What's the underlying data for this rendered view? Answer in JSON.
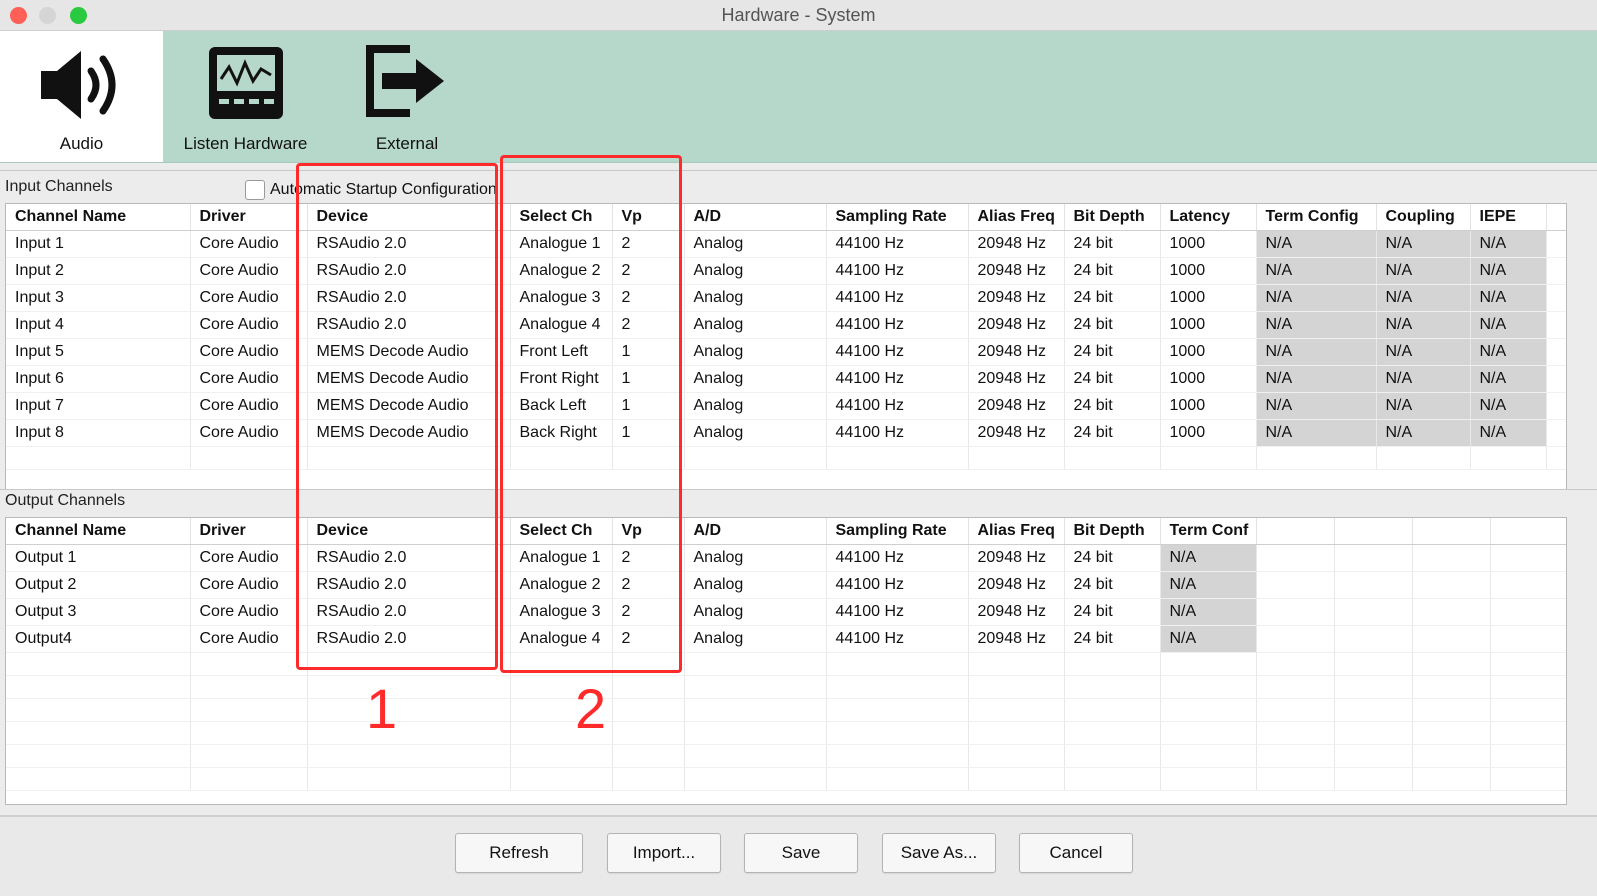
{
  "window": {
    "title": "Hardware - System"
  },
  "toolbar": {
    "items": [
      {
        "label": "Audio",
        "icon": "speaker-icon",
        "selected": true
      },
      {
        "label": "Listen Hardware",
        "icon": "waveform-monitor-icon",
        "selected": false
      },
      {
        "label": "External",
        "icon": "export-arrow-icon",
        "selected": false
      }
    ]
  },
  "input_section": {
    "label": "Input Channels",
    "auto_startup_label": "Automatic Startup Configuration",
    "auto_startup_checked": false,
    "columns": [
      "Channel Name",
      "Driver",
      "Device",
      "Select Ch",
      "Vp",
      "A/D",
      "Sampling Rate",
      "Alias Freq",
      "Bit Depth",
      "Latency",
      "Term Config",
      "Coupling",
      "IEPE"
    ],
    "rows": [
      [
        "Input 1",
        "Core Audio",
        "RSAudio 2.0",
        "Analogue 1",
        "2",
        "Analog",
        "44100 Hz",
        "20948 Hz",
        "24 bit",
        "1000",
        "N/A",
        "N/A",
        "N/A"
      ],
      [
        "Input 2",
        "Core Audio",
        "RSAudio 2.0",
        "Analogue 2",
        "2",
        "Analog",
        "44100 Hz",
        "20948 Hz",
        "24 bit",
        "1000",
        "N/A",
        "N/A",
        "N/A"
      ],
      [
        "Input 3",
        "Core Audio",
        "RSAudio 2.0",
        "Analogue 3",
        "2",
        "Analog",
        "44100 Hz",
        "20948 Hz",
        "24 bit",
        "1000",
        "N/A",
        "N/A",
        "N/A"
      ],
      [
        "Input 4",
        "Core Audio",
        "RSAudio 2.0",
        "Analogue 4",
        "2",
        "Analog",
        "44100 Hz",
        "20948 Hz",
        "24 bit",
        "1000",
        "N/A",
        "N/A",
        "N/A"
      ],
      [
        "Input 5",
        "Core Audio",
        "MEMS Decode Audio",
        "Front Left",
        "1",
        "Analog",
        "44100 Hz",
        "20948 Hz",
        "24 bit",
        "1000",
        "N/A",
        "N/A",
        "N/A"
      ],
      [
        "Input 6",
        "Core Audio",
        "MEMS Decode Audio",
        "Front Right",
        "1",
        "Analog",
        "44100 Hz",
        "20948 Hz",
        "24 bit",
        "1000",
        "N/A",
        "N/A",
        "N/A"
      ],
      [
        "Input 7",
        "Core Audio",
        "MEMS Decode Audio",
        "Back Left",
        "1",
        "Analog",
        "44100 Hz",
        "20948 Hz",
        "24 bit",
        "1000",
        "N/A",
        "N/A",
        "N/A"
      ],
      [
        "Input 8",
        "Core Audio",
        "MEMS Decode Audio",
        "Back Right",
        "1",
        "Analog",
        "44100 Hz",
        "20948 Hz",
        "24 bit",
        "1000",
        "N/A",
        "N/A",
        "N/A"
      ]
    ]
  },
  "output_section": {
    "label": "Output Channels",
    "columns": [
      "Channel Name",
      "Driver",
      "Device",
      "Select Ch",
      "Vp",
      "A/D",
      "Sampling Rate",
      "Alias Freq",
      "Bit Depth",
      "Term Conf"
    ],
    "rows": [
      [
        "Output 1",
        "Core Audio",
        "RSAudio 2.0",
        "Analogue 1",
        "2",
        "Analog",
        "44100 Hz",
        "20948 Hz",
        "24 bit",
        "N/A"
      ],
      [
        "Output 2",
        "Core Audio",
        "RSAudio 2.0",
        "Analogue 2",
        "2",
        "Analog",
        "44100 Hz",
        "20948 Hz",
        "24 bit",
        "N/A"
      ],
      [
        "Output 3",
        "Core Audio",
        "RSAudio 2.0",
        "Analogue 3",
        "2",
        "Analog",
        "44100 Hz",
        "20948 Hz",
        "24 bit",
        "N/A"
      ],
      [
        "Output4",
        "Core Audio",
        "RSAudio 2.0",
        "Analogue 4",
        "2",
        "Analog",
        "44100 Hz",
        "20948 Hz",
        "24 bit",
        "N/A"
      ]
    ]
  },
  "annotations": {
    "label_1": "1",
    "label_2": "2",
    "color": "#ff2a2a"
  },
  "buttons": {
    "refresh": "Refresh",
    "import": "Import...",
    "save": "Save",
    "save_as": "Save As...",
    "cancel": "Cancel"
  },
  "colors": {
    "toolbar_bg": "#b5d8cb",
    "readonly_cell": "#d4d4d4"
  }
}
